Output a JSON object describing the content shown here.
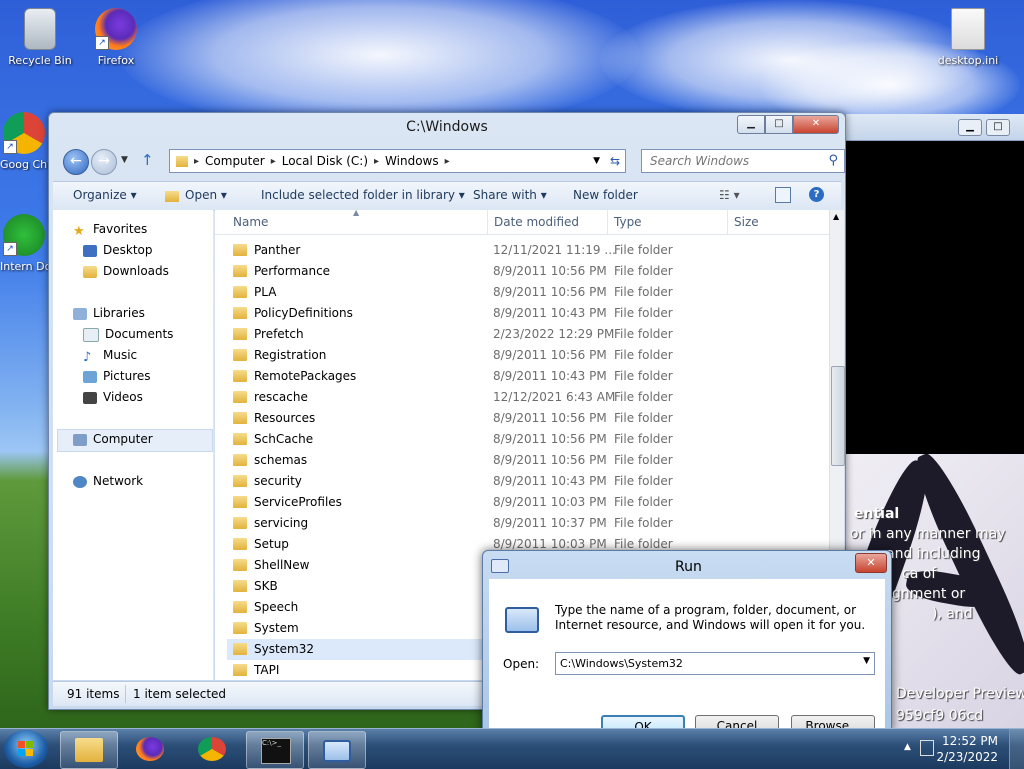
{
  "desktop": {
    "icons": [
      {
        "label": "Recycle Bin"
      },
      {
        "label": "Firefox"
      },
      {
        "label": "desktop.ini"
      },
      {
        "label": "Goog Chron"
      },
      {
        "label": "Intern Downl"
      }
    ],
    "wallpaper_text": [
      "ential",
      "or in any manner may",
      "and including",
      "ca of",
      "gnment or",
      "), and",
      "Developer Preview",
      "959cf9 06cd"
    ]
  },
  "explorer": {
    "title": "C:\\Windows",
    "caption_buttons": {
      "minimize": "▁",
      "maximize": "□",
      "close": "✕"
    },
    "address": {
      "crumbs": [
        "Computer",
        "Local Disk (C:)",
        "Windows"
      ]
    },
    "search": {
      "placeholder": "Search Windows"
    },
    "toolbar": {
      "organize": "Organize ▾",
      "open": "Open ▾",
      "include": "Include selected folder in library ▾",
      "share": "Share with ▾",
      "new_folder": "New folder"
    },
    "nav": {
      "favorites": "Favorites",
      "desktop": "Desktop",
      "downloads": "Downloads",
      "libraries": "Libraries",
      "documents": "Documents",
      "music": "Music",
      "pictures": "Pictures",
      "videos": "Videos",
      "computer": "Computer",
      "network": "Network"
    },
    "columns": {
      "name": "Name",
      "date": "Date modified",
      "type": "Type",
      "size": "Size"
    },
    "rows": [
      {
        "name": "Panther",
        "date": "12/11/2021 11:19 ...",
        "type": "File folder"
      },
      {
        "name": "Performance",
        "date": "8/9/2011 10:56 PM",
        "type": "File folder"
      },
      {
        "name": "PLA",
        "date": "8/9/2011 10:56 PM",
        "type": "File folder"
      },
      {
        "name": "PolicyDefinitions",
        "date": "8/9/2011 10:43 PM",
        "type": "File folder"
      },
      {
        "name": "Prefetch",
        "date": "2/23/2022 12:29 PM",
        "type": "File folder"
      },
      {
        "name": "Registration",
        "date": "8/9/2011 10:56 PM",
        "type": "File folder"
      },
      {
        "name": "RemotePackages",
        "date": "8/9/2011 10:43 PM",
        "type": "File folder"
      },
      {
        "name": "rescache",
        "date": "12/12/2021 6:43 AM",
        "type": "File folder"
      },
      {
        "name": "Resources",
        "date": "8/9/2011 10:56 PM",
        "type": "File folder"
      },
      {
        "name": "SchCache",
        "date": "8/9/2011 10:56 PM",
        "type": "File folder"
      },
      {
        "name": "schemas",
        "date": "8/9/2011 10:56 PM",
        "type": "File folder"
      },
      {
        "name": "security",
        "date": "8/9/2011 10:43 PM",
        "type": "File folder"
      },
      {
        "name": "ServiceProfiles",
        "date": "8/9/2011 10:03 PM",
        "type": "File folder"
      },
      {
        "name": "servicing",
        "date": "8/9/2011 10:37 PM",
        "type": "File folder"
      },
      {
        "name": "Setup",
        "date": "8/9/2011 10:03 PM",
        "type": "File folder"
      },
      {
        "name": "ShellNew",
        "date": "",
        "type": ""
      },
      {
        "name": "SKB",
        "date": "",
        "type": ""
      },
      {
        "name": "Speech",
        "date": "",
        "type": ""
      },
      {
        "name": "System",
        "date": "",
        "type": ""
      },
      {
        "name": "System32",
        "date": "",
        "type": ""
      },
      {
        "name": "TAPI",
        "date": "",
        "type": ""
      }
    ],
    "selected_row": "System32",
    "status": {
      "count": "91 items",
      "selected": "1 item selected"
    }
  },
  "run": {
    "title": "Run",
    "close": "✕",
    "description": "Type the name of a program, folder, document, or Internet resource, and Windows will open it for you.",
    "open_label": "Open:",
    "open_value": "C:\\Windows\\System32",
    "ok": "OK",
    "cancel": "Cancel",
    "browse": "Browse..."
  },
  "taskbar": {
    "time": "12:52 PM",
    "date": "2/23/2022"
  },
  "colors": {
    "accent": "#3c7fb1",
    "selection": "#dbe9fb",
    "folder": "#e3b23c"
  }
}
